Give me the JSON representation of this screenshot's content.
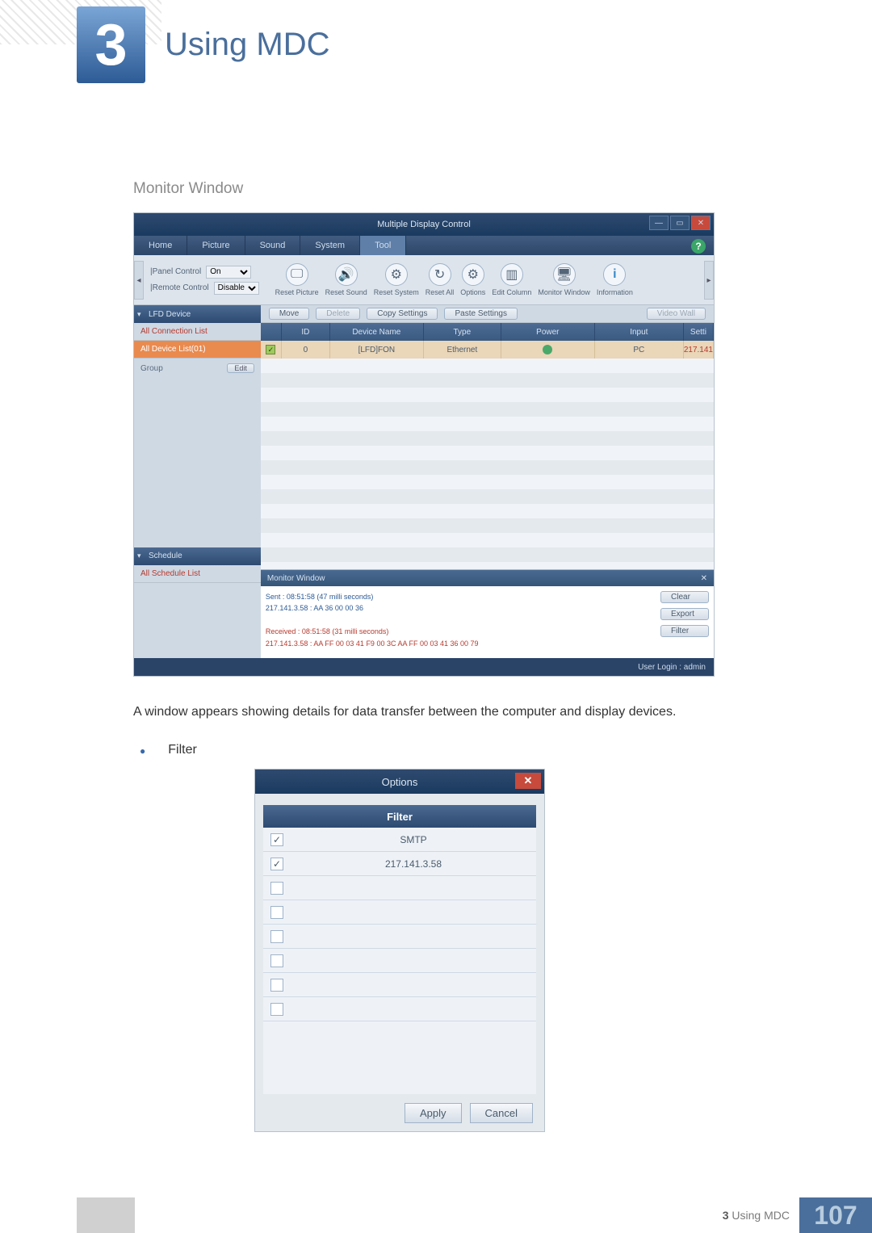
{
  "chapter": {
    "number": "3",
    "title": "Using MDC"
  },
  "section_heading": "Monitor Window",
  "shot1": {
    "window_title": "Multiple Display Control",
    "tabs": [
      "Home",
      "Picture",
      "Sound",
      "System",
      "Tool"
    ],
    "panel_control_label": "|Panel Control",
    "panel_control_value": "On",
    "remote_control_label": "|Remote Control",
    "remote_control_value": "Disable",
    "tool_icons": [
      {
        "label": "Reset Picture"
      },
      {
        "label": "Reset Sound"
      },
      {
        "label": "Reset System"
      },
      {
        "label": "Reset All"
      },
      {
        "label": "Options"
      },
      {
        "label": "Edit Column"
      },
      {
        "label": "Monitor Window"
      },
      {
        "label": "Information"
      }
    ],
    "sidebar": {
      "header1": "LFD Device",
      "sub_all_conn": "All Connection List",
      "sub_all_dev": "All Device List(01)",
      "group_label": "Group",
      "edit_label": "Edit",
      "header2": "Schedule",
      "sub_all_sched": "All Schedule List"
    },
    "toolbar_btns": {
      "move": "Move",
      "delete": "Delete",
      "copy": "Copy Settings",
      "paste": "Paste Settings",
      "videowall": "Video Wall"
    },
    "grid_headers": {
      "id": "ID",
      "name": "Device Name",
      "type": "Type",
      "power": "Power",
      "input": "Input",
      "setti": "Setti"
    },
    "grid_row": {
      "id": "0",
      "name": "[LFD]FON",
      "type": "Ethernet",
      "input": "PC",
      "setti": "217.141"
    },
    "monwin": {
      "title": "Monitor Window",
      "sent_l1": "Sent : 08:51:58 (47 milli seconds)",
      "sent_l2": "217.141.3.58 : AA 36 00 00 36",
      "recv_l1": "Received : 08:51:58 (31 milli seconds)",
      "recv_l2": "217.141.3.58 : AA FF 00 03 41 F9 00 3C AA FF 00 03 41 36 00 79",
      "btn_clear": "Clear",
      "btn_export": "Export",
      "btn_filter": "Filter"
    },
    "status": "User Login : admin"
  },
  "caption": "A window appears showing details for data transfer between the computer and display devices.",
  "bullet": "Filter",
  "shot2": {
    "title": "Options",
    "filter_header": "Filter",
    "rows": [
      {
        "checked": true,
        "label": "SMTP"
      },
      {
        "checked": true,
        "label": "217.141.3.58"
      }
    ],
    "apply": "Apply",
    "cancel": "Cancel"
  },
  "footer": {
    "text_prefix": "3",
    "text": "Using MDC",
    "page": "107"
  }
}
